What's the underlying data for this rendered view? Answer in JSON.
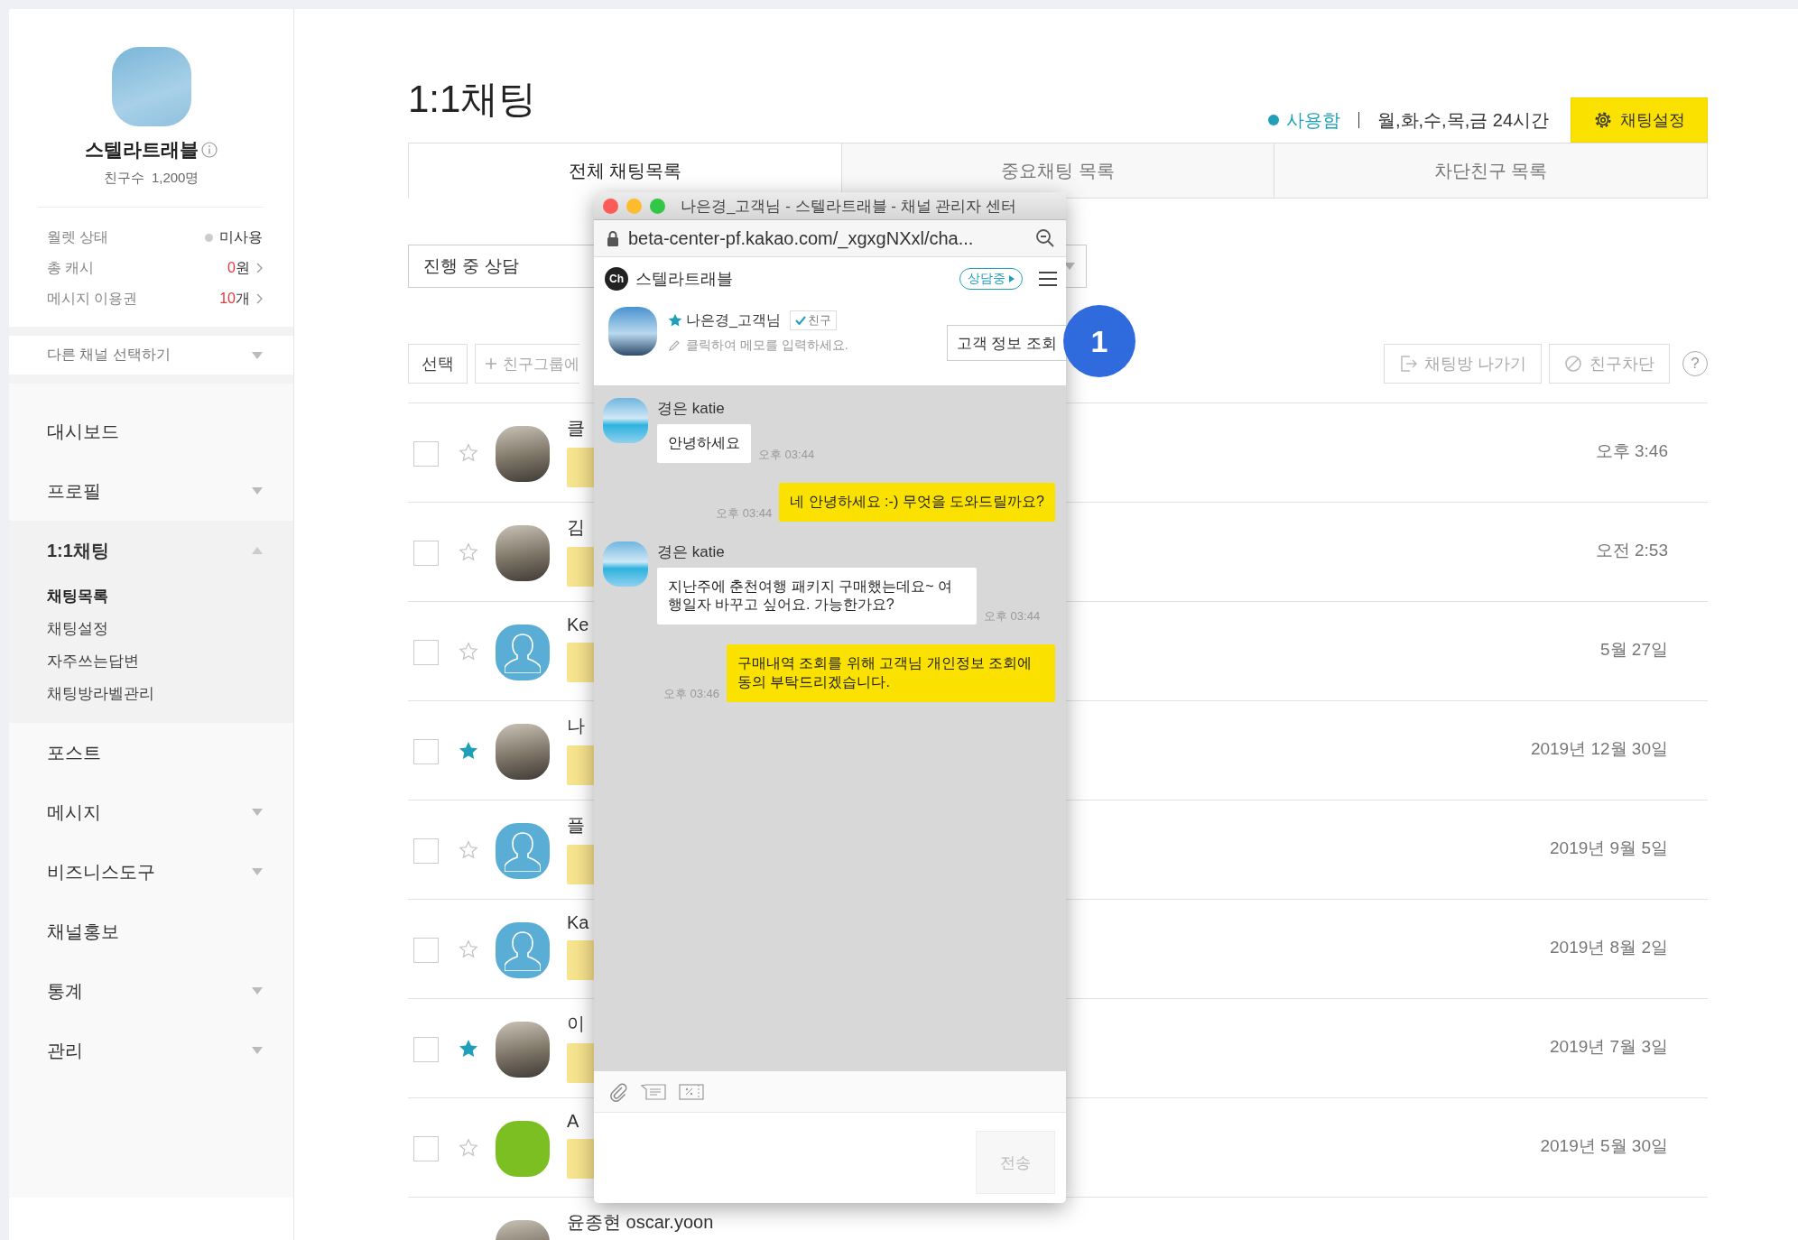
{
  "sidebar": {
    "channel_name": "스텔라트래블",
    "friends": "친구수  1,200명",
    "stats": [
      {
        "label": "월렛 상태",
        "kind": "status",
        "on": false,
        "value": "미사용"
      },
      {
        "label": "총 캐시",
        "kind": "link",
        "value": "0",
        "unit": "원"
      },
      {
        "label": "메시지 이용권",
        "kind": "link",
        "value": "10",
        "unit": "개"
      }
    ],
    "channel_select": "다른 채널 선택하기",
    "nav": [
      {
        "label": "대시보드",
        "kind": "link"
      },
      {
        "label": "프로필",
        "kind": "group",
        "expanded": false
      },
      {
        "label": "1:1채팅",
        "kind": "group",
        "expanded": true,
        "children": [
          {
            "label": "채팅목록",
            "selected": true
          },
          {
            "label": "채팅설정",
            "selected": false
          },
          {
            "label": "자주쓰는답변",
            "selected": false
          },
          {
            "label": "채팅방라벨관리",
            "selected": false
          }
        ]
      },
      {
        "label": "포스트",
        "kind": "link"
      },
      {
        "label": "메시지",
        "kind": "group",
        "expanded": false
      },
      {
        "label": "비즈니스도구",
        "kind": "group",
        "expanded": false
      },
      {
        "label": "채널홍보",
        "kind": "link"
      },
      {
        "label": "통계",
        "kind": "group",
        "expanded": false
      },
      {
        "label": "관리",
        "kind": "group",
        "expanded": false
      }
    ]
  },
  "page": {
    "title": "1:1채팅",
    "chat_status": {
      "label": "사용함",
      "on": true
    },
    "hours": "월,화,수,목,금  24시간",
    "settings_button": "채팅설정"
  },
  "tabs": [
    {
      "label": "전체 채팅목록",
      "selected": true
    },
    {
      "label": "중요채팅 목록",
      "selected": false
    },
    {
      "label": "차단친구 목록",
      "selected": false
    }
  ],
  "filter": {
    "value": "진행 중 상담"
  },
  "toolbar": {
    "select_button": "선택",
    "group_button": "친구그룹에",
    "leave_button": "채팅방 나가기",
    "block_button": "친구차단",
    "help": "?"
  },
  "chats": [
    {
      "kind": "photo",
      "name": "클",
      "checked": false,
      "starred": false,
      "time": "오후 3:46"
    },
    {
      "kind": "photo",
      "name": "김",
      "checked": false,
      "starred": false,
      "time": "오전 2:53"
    },
    {
      "kind": "default",
      "name": "Ke",
      "checked": false,
      "starred": false,
      "time": "5월 27일"
    },
    {
      "kind": "photo",
      "name": "나",
      "checked": false,
      "starred": true,
      "time": "2019년 12월 30일"
    },
    {
      "kind": "default",
      "name": "플",
      "checked": false,
      "starred": false,
      "time": "2019년 9월 5일"
    },
    {
      "kind": "default",
      "name": "Ka",
      "checked": false,
      "starred": false,
      "time": "2019년 8월 2일"
    },
    {
      "kind": "photo",
      "name": "이",
      "checked": false,
      "starred": true,
      "time": "2019년 7월 3일"
    },
    {
      "kind": "logo",
      "name": "A",
      "checked": false,
      "starred": false,
      "time": "2019년 5월 30일"
    },
    {
      "kind": "photo",
      "name": "윤종현 oscar.yoon"
    }
  ],
  "popup": {
    "title": "나은경_고객님 - 스텔라트래블 - 채널 관리자 센터",
    "url": "beta-center-pf.kakao.com/_xgxgNXxl/cha...",
    "channel_logo": "Ch",
    "channel_name": "스텔라트래블",
    "status_badge": "상담중",
    "customer": {
      "name": "나은경_고객님",
      "starred": true,
      "friend_badge": "친구",
      "memo_placeholder": "클릭하여 메모를 입력하세요."
    },
    "lookup_button": "고객 정보 조회",
    "messages": [
      {
        "kind": "received",
        "sender": "경은 katie",
        "text": "안녕하세요",
        "time": "오후 03:44"
      },
      {
        "kind": "sent",
        "text": "네 안녕하세요 :-) 무엇을 도와드릴까요?",
        "time": "오후 03:44"
      },
      {
        "kind": "received",
        "sender": "경은 katie",
        "text": "지난주에 춘천여행 패키지 구매했는데요~ 여행일자 바꾸고 싶어요. 가능한가요?",
        "time": "오후 03:44"
      },
      {
        "kind": "sent",
        "text": "구매내역 조회를 위해 고객님 개인정보 조회에 동의 부탁드리겠습니다.",
        "time": "오후 03:46"
      }
    ],
    "send_button": "전송",
    "send_disabled": true,
    "callout": "1"
  }
}
